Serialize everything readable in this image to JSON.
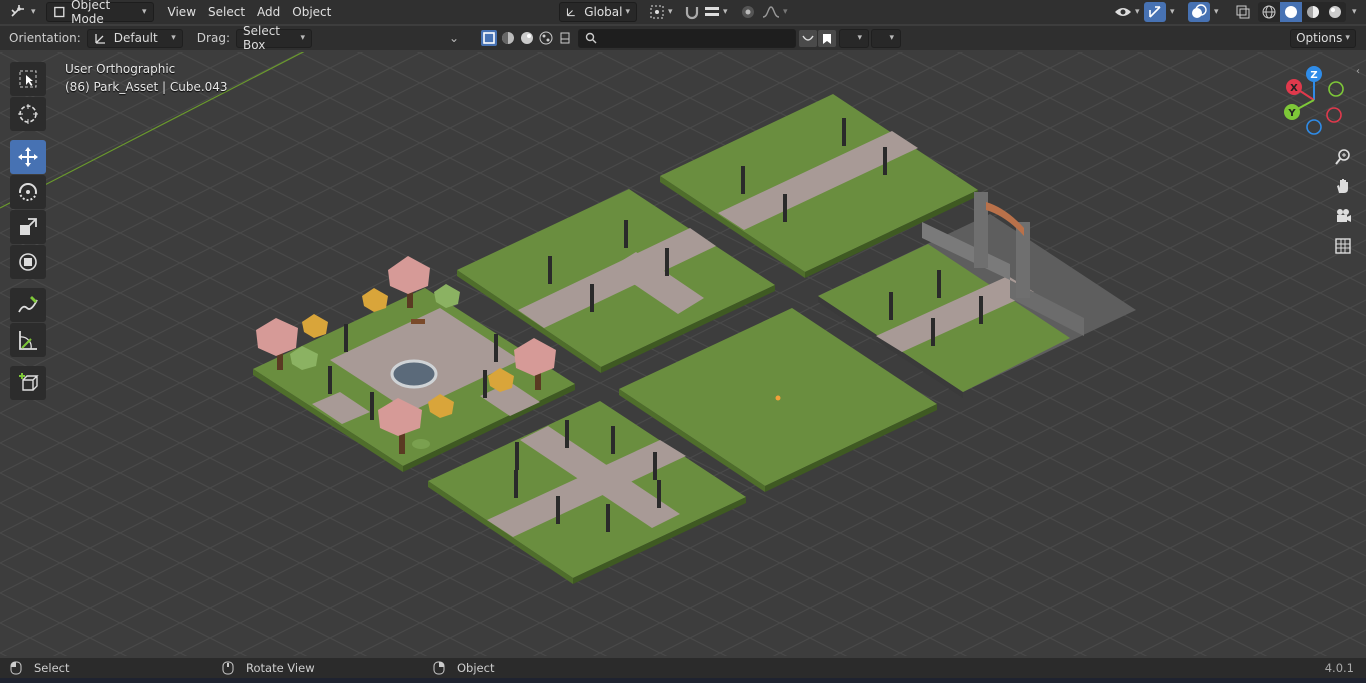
{
  "header": {
    "editor_icon": "editor-type-icon",
    "mode": "Object Mode",
    "menus": [
      "View",
      "Select",
      "Add",
      "Object"
    ],
    "transform_orientation": "Global"
  },
  "tool_settings": {
    "orientation_label": "Orientation:",
    "orientation_value": "Default",
    "drag_label": "Drag:",
    "drag_value": "Select Box",
    "search_placeholder": "",
    "options_label": "Options"
  },
  "viewport": {
    "view_name": "User Orthographic",
    "object_info": "(86) Park_Asset | Cube.043",
    "gizmo_axes": {
      "x": "X",
      "y": "Y",
      "z": "Z"
    }
  },
  "tools": [
    {
      "name": "select-box-tool",
      "active": false
    },
    {
      "name": "cursor-tool",
      "active": false
    },
    {
      "name": "move-tool",
      "active": true
    },
    {
      "name": "rotate-tool",
      "active": false
    },
    {
      "name": "scale-tool",
      "active": false
    },
    {
      "name": "transform-tool",
      "active": false
    },
    {
      "name": "annotate-tool",
      "active": false
    },
    {
      "name": "measure-tool",
      "active": false
    },
    {
      "name": "add-cube-tool",
      "active": false
    }
  ],
  "status_bar": {
    "left_action": "Select",
    "middle_action": "Rotate View",
    "right_action": "Object",
    "version": "4.0.1"
  },
  "colors": {
    "grass": "#6a8e3f",
    "path": "#a89a96",
    "active_tool": "#4772b3",
    "x_axis": "#e0394c",
    "y_axis": "#7ec838",
    "z_axis": "#2f8ce8"
  }
}
